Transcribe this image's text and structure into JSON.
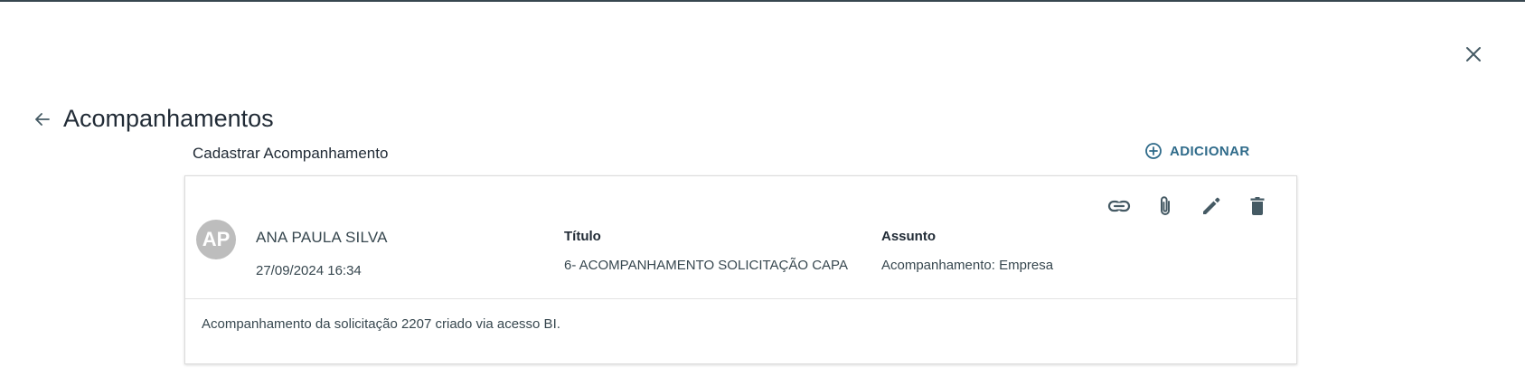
{
  "header": {
    "page_title": "Acompanhamentos",
    "section_title": "Cadastrar Acompanhamento",
    "add_label": "ADICIONAR"
  },
  "entry": {
    "avatar_initials": "AP",
    "author": "ANA PAULA SILVA",
    "datetime": "27/09/2024 16:34",
    "title_label": "Título",
    "title_value": "6- ACOMPANHAMENTO SOLICITAÇÃO CAPA",
    "subject_label": "Assunto",
    "subject_value": "Acompanhamento: Empresa",
    "description": "Acompanhamento da solicitação 2207 criado via acesso BI."
  },
  "icons": {
    "close": "close-icon",
    "back": "arrow-back-icon",
    "add": "add-circle-icon",
    "link": "link-icon",
    "attach": "paperclip-icon",
    "edit": "pencil-icon",
    "delete": "trash-icon"
  },
  "colors": {
    "accent": "#2f6b8a",
    "icon": "#455a64",
    "avatar_bg": "#bdbdbd"
  }
}
